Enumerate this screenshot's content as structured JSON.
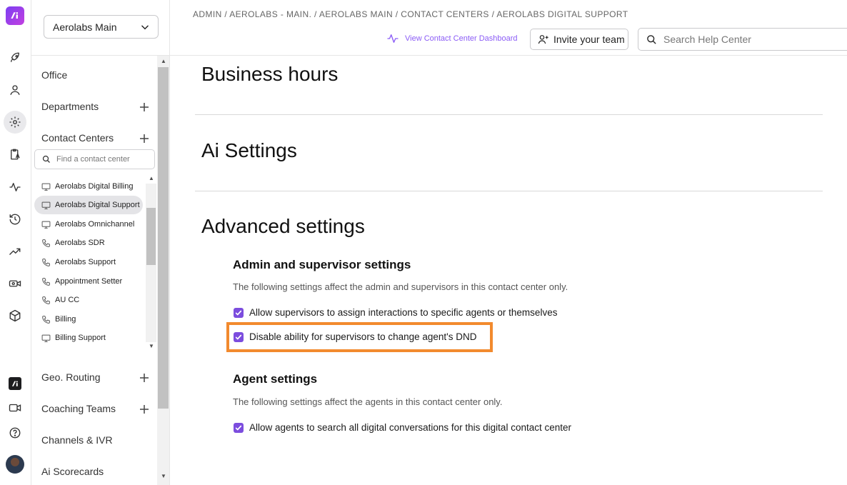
{
  "rail": {
    "icons": [
      "rocket-icon",
      "user-icon",
      "gear-icon",
      "clipboard-icon",
      "activity-icon",
      "history-icon",
      "trending-icon",
      "video-settings-icon",
      "cube-icon",
      "ai-logo-icon",
      "video-icon",
      "help-icon",
      "avatar"
    ]
  },
  "sidebar": {
    "workspace": "Aerolabs Main",
    "nav": {
      "office": "Office",
      "departments": "Departments",
      "contact_centers": "Contact Centers",
      "geo_routing": "Geo. Routing",
      "coaching_teams": "Coaching Teams",
      "channels_ivr": "Channels & IVR",
      "ai_scorecards": "Ai Scorecards"
    },
    "search_placeholder": "Find a contact center",
    "contact_centers": [
      {
        "label": "Aerolabs Digital Billing",
        "icon": "monitor-icon"
      },
      {
        "label": "Aerolabs Digital Support",
        "icon": "monitor-icon",
        "selected": true
      },
      {
        "label": "Aerolabs Omnichannel",
        "icon": "monitor-icon"
      },
      {
        "label": "Aerolabs SDR",
        "icon": "phone-icon"
      },
      {
        "label": "Aerolabs Support",
        "icon": "phone-icon"
      },
      {
        "label": "Appointment Setter",
        "icon": "phone-icon"
      },
      {
        "label": "AU CC",
        "icon": "phone-icon"
      },
      {
        "label": "Billing",
        "icon": "phone-icon"
      },
      {
        "label": "Billing Support",
        "icon": "monitor-icon"
      }
    ]
  },
  "header": {
    "breadcrumb": "ADMIN / AEROLABS - MAIN. / AEROLABS MAIN / CONTACT CENTERS / AEROLABS DIGITAL SUPPORT",
    "dashboard_link": "View Contact Center Dashboard",
    "invite_button": "Invite your team",
    "help_search_placeholder": "Search Help Center"
  },
  "main": {
    "business_hours": "Business hours",
    "ai_settings": "Ai Settings",
    "advanced_settings": "Advanced settings",
    "admin_section": {
      "title": "Admin and supervisor settings",
      "description": "The following settings affect the admin and supervisors in this contact center only.",
      "options": [
        {
          "label": "Allow supervisors to assign interactions to specific agents or themselves",
          "checked": true
        },
        {
          "label": "Disable ability for supervisors to change agent's DND",
          "checked": true
        }
      ]
    },
    "agent_section": {
      "title": "Agent settings",
      "description": "The following settings affect the agents in this contact center only.",
      "options": [
        {
          "label": "Allow agents to search all digital conversations for this digital contact center",
          "checked": true
        }
      ]
    }
  },
  "colors": {
    "accent": "#7c4dde",
    "link": "#8b5cf6",
    "highlight": "#f28a2e",
    "selected_bg": "#e4e4e7"
  }
}
